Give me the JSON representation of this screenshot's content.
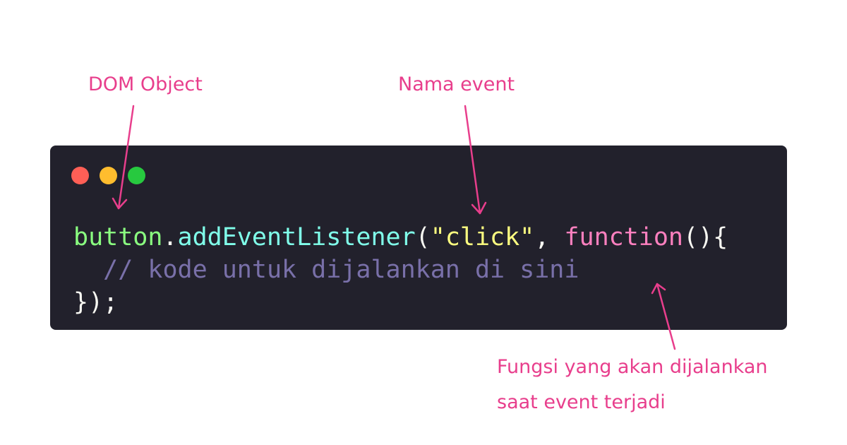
{
  "annotations": {
    "dom_object": "DOM Object",
    "event_name": "Nama event",
    "function_line1": "Fungsi yang akan dijalankan",
    "function_line2": "saat event terjadi"
  },
  "code": {
    "line1": {
      "object": "button",
      "dot": ".",
      "method": "addEventListener",
      "open_paren": "(",
      "event": "\"click\"",
      "comma": ", ",
      "keyword": "function",
      "params_brace": "(){"
    },
    "line2": {
      "indent": "  ",
      "comment": "// kode untuk dijalankan di sini"
    },
    "line3": {
      "close": "});"
    }
  },
  "window_controls": [
    "close-dot",
    "minimize-dot",
    "maximize-dot"
  ],
  "colors": {
    "annotation": "#e83e8c",
    "editor_background": "#22212c",
    "object": "#8aff80",
    "method": "#80ffea",
    "string": "#ffff80",
    "keyword": "#ff80bf",
    "comment": "#7970a9",
    "plain": "#f8f8f2",
    "dot_red": "#ff5f56",
    "dot_yellow": "#ffbd2e",
    "dot_green": "#27c93f"
  }
}
